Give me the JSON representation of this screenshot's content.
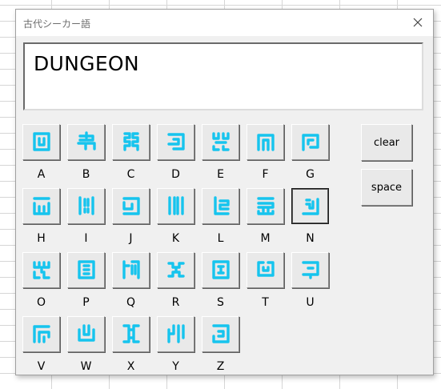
{
  "window": {
    "title": "古代シーカー語",
    "close_icon": "close-icon"
  },
  "display": {
    "text": "DUNGEON"
  },
  "controls": {
    "clear_label": "clear",
    "space_label": "space"
  },
  "glyph_color": "#16c4ee",
  "selected_key": "N",
  "keys": [
    {
      "letter": "A",
      "icon": "sheikah-a-icon"
    },
    {
      "letter": "B",
      "icon": "sheikah-b-icon"
    },
    {
      "letter": "C",
      "icon": "sheikah-c-icon"
    },
    {
      "letter": "D",
      "icon": "sheikah-d-icon"
    },
    {
      "letter": "E",
      "icon": "sheikah-e-icon"
    },
    {
      "letter": "F",
      "icon": "sheikah-f-icon"
    },
    {
      "letter": "G",
      "icon": "sheikah-g-icon"
    },
    {
      "letter": "H",
      "icon": "sheikah-h-icon"
    },
    {
      "letter": "I",
      "icon": "sheikah-i-icon"
    },
    {
      "letter": "J",
      "icon": "sheikah-j-icon"
    },
    {
      "letter": "K",
      "icon": "sheikah-k-icon"
    },
    {
      "letter": "L",
      "icon": "sheikah-l-icon"
    },
    {
      "letter": "M",
      "icon": "sheikah-m-icon"
    },
    {
      "letter": "N",
      "icon": "sheikah-n-icon"
    },
    {
      "letter": "O",
      "icon": "sheikah-o-icon"
    },
    {
      "letter": "P",
      "icon": "sheikah-p-icon"
    },
    {
      "letter": "Q",
      "icon": "sheikah-q-icon"
    },
    {
      "letter": "R",
      "icon": "sheikah-r-icon"
    },
    {
      "letter": "S",
      "icon": "sheikah-s-icon"
    },
    {
      "letter": "T",
      "icon": "sheikah-t-icon"
    },
    {
      "letter": "U",
      "icon": "sheikah-u-icon"
    },
    {
      "letter": "V",
      "icon": "sheikah-v-icon"
    },
    {
      "letter": "W",
      "icon": "sheikah-w-icon"
    },
    {
      "letter": "X",
      "icon": "sheikah-x-icon"
    },
    {
      "letter": "Y",
      "icon": "sheikah-y-icon"
    },
    {
      "letter": "Z",
      "icon": "sheikah-z-icon"
    }
  ]
}
